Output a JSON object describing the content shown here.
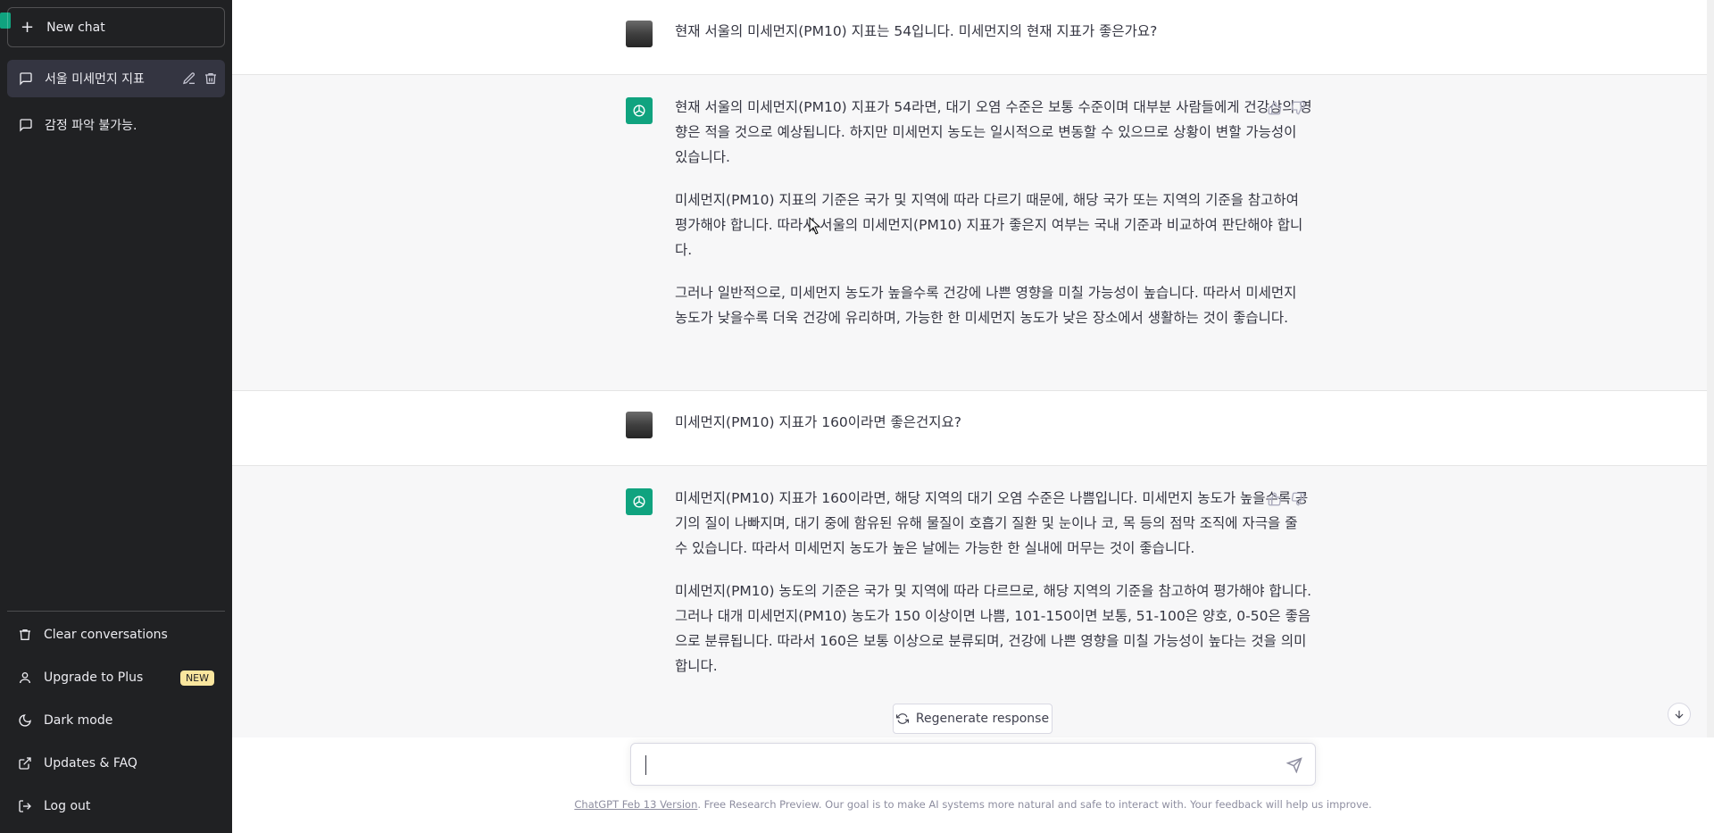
{
  "sidebar": {
    "new_chat": "New chat",
    "conversations": [
      {
        "label": "서울 미세먼지 지표",
        "active": true
      },
      {
        "label": "감정 파악 불가능.",
        "active": false
      }
    ],
    "links": {
      "clear": "Clear conversations",
      "upgrade": "Upgrade to Plus",
      "upgrade_badge": "NEW",
      "dark": "Dark mode",
      "updates": "Updates & FAQ",
      "logout": "Log out"
    }
  },
  "messages": [
    {
      "role": "user",
      "text": "현재 서울의 미세먼지(PM10) 지표는 54입니다. 미세먼지의 현재 지표가 좋은가요?"
    },
    {
      "role": "assistant",
      "paragraphs": [
        "현재 서울의 미세먼지(PM10) 지표가 54라면, 대기 오염 수준은 보통 수준이며 대부분 사람들에게 건강상의 영향은 적을 것으로 예상됩니다. 하지만 미세먼지 농도는 일시적으로 변동할 수 있으므로 상황이 변할 가능성이 있습니다.",
        "미세먼지(PM10) 지표의 기준은 국가 및 지역에 따라 다르기 때문에, 해당 국가 또는 지역의 기준을 참고하여 평가해야 합니다. 따라서 서울의 미세먼지(PM10) 지표가 좋은지 여부는 국내 기준과 비교하여 판단해야 합니다.",
        "그러나 일반적으로, 미세먼지 농도가 높을수록 건강에 나쁜 영향을 미칠 가능성이 높습니다. 따라서 미세먼지 농도가 낮을수록 더욱 건강에 유리하며, 가능한 한 미세먼지 농도가 낮은 장소에서 생활하는 것이 좋습니다."
      ]
    },
    {
      "role": "user",
      "text": "미세먼지(PM10) 지표가 160이라면 좋은건지요?"
    },
    {
      "role": "assistant",
      "paragraphs": [
        "미세먼지(PM10) 지표가 160이라면, 해당 지역의 대기 오염 수준은 나쁨입니다. 미세먼지 농도가 높을수록 공기의 질이 나빠지며, 대기 중에 함유된 유해 물질이 호흡기 질환 및 눈이나 코, 목 등의 점막 조직에 자극을 줄 수 있습니다. 따라서 미세먼지 농도가 높은 날에는 가능한 한 실내에 머무는 것이 좋습니다.",
        "미세먼지(PM10) 농도의 기준은 국가 및 지역에 따라 다르므로, 해당 지역의 기준을 참고하여 평가해야 합니다. 그러나 대개 미세먼지(PM10) 농도가 150 이상이면 나쁨, 101-150이면 보통, 51-100은 양호, 0-50은 좋음으로 분류됩니다. 따라서 160은 보통 이상으로 분류되며, 건강에 나쁜 영향을 미칠 가능성이 높다는 것을 의미합니다."
      ]
    }
  ],
  "regenerate_label": "Regenerate response",
  "composer": {
    "value": ""
  },
  "footer": {
    "version_link": "ChatGPT Feb 13 Version",
    "text": ". Free Research Preview. Our goal is to make AI systems more natural and safe to interact with. Your feedback will help us improve."
  },
  "colors": {
    "sidebar": "#202123",
    "accent": "#10a37f",
    "assistant_bg": "#f7f7f8"
  }
}
